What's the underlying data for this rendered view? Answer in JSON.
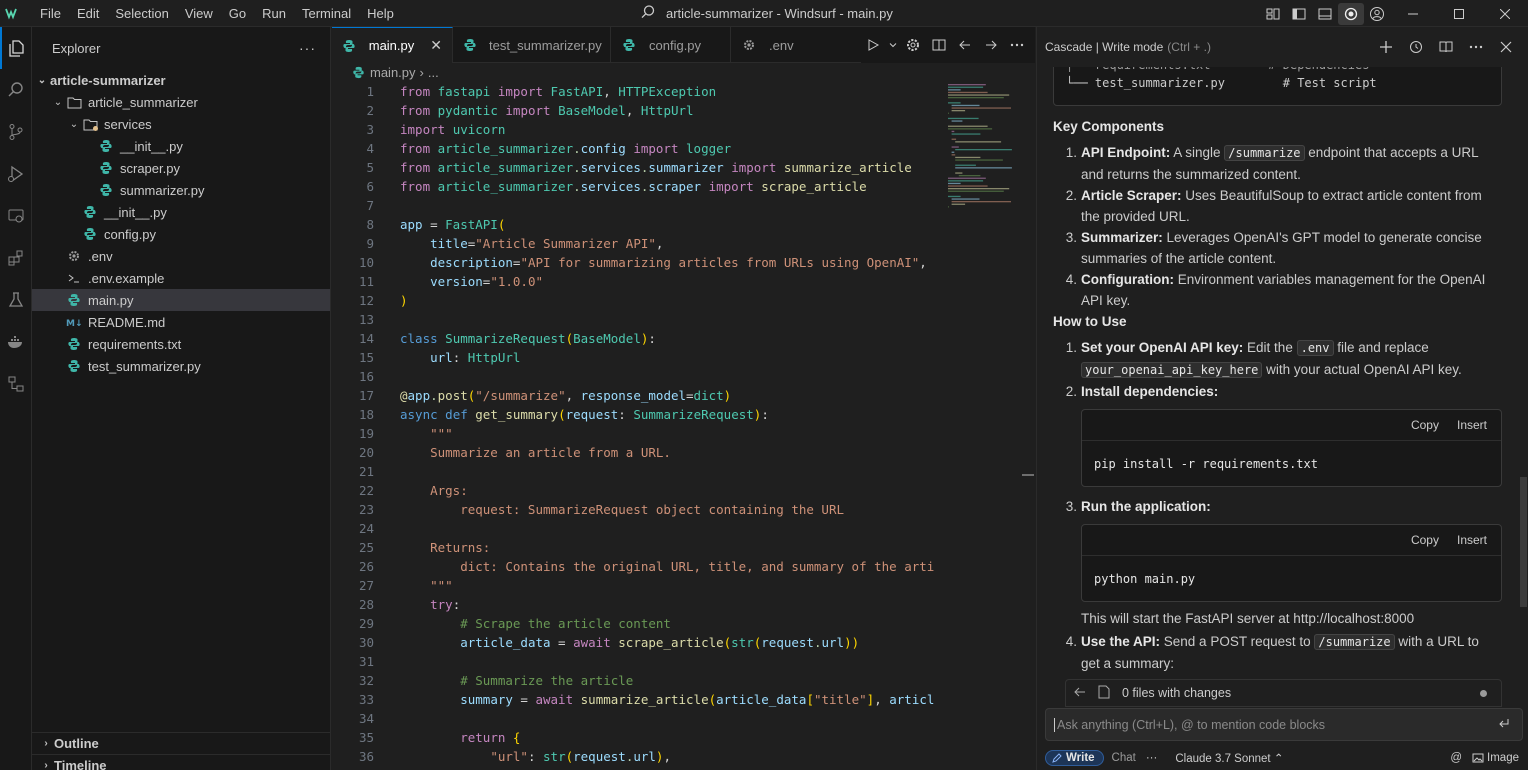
{
  "titlebar": {
    "menu": [
      "File",
      "Edit",
      "Selection",
      "View",
      "Go",
      "Run",
      "Terminal",
      "Help"
    ],
    "window_title": "article-summarizer - Windsurf - main.py",
    "window_controls": [
      "minimize",
      "maximize",
      "close"
    ]
  },
  "activity_bar": [
    "explorer-icon",
    "search-icon",
    "source-control-icon",
    "run-debug-icon",
    "remote-explorer-icon",
    "extensions-icon",
    "testing-icon",
    "docker-icon",
    "hierarchy-icon"
  ],
  "explorer": {
    "title": "Explorer",
    "more": "···",
    "root": "article-summarizer",
    "items": [
      {
        "label": "article_summarizer",
        "depth": 1,
        "type": "folder",
        "expanded": true
      },
      {
        "label": "services",
        "depth": 2,
        "type": "folder",
        "expanded": true
      },
      {
        "label": "__init__.py",
        "depth": 3,
        "type": "python"
      },
      {
        "label": "scraper.py",
        "depth": 3,
        "type": "python"
      },
      {
        "label": "summarizer.py",
        "depth": 3,
        "type": "python"
      },
      {
        "label": "__init__.py",
        "depth": 2,
        "type": "python"
      },
      {
        "label": "config.py",
        "depth": 2,
        "type": "python"
      },
      {
        "label": ".env",
        "depth": 1,
        "type": "env"
      },
      {
        "label": ".env.example",
        "depth": 1,
        "type": "shell"
      },
      {
        "label": "main.py",
        "depth": 1,
        "type": "python",
        "selected": true
      },
      {
        "label": "README.md",
        "depth": 1,
        "type": "markdown"
      },
      {
        "label": "requirements.txt",
        "depth": 1,
        "type": "python"
      },
      {
        "label": "test_summarizer.py",
        "depth": 1,
        "type": "python"
      }
    ],
    "outline_label": "Outline",
    "timeline_label": "Timeline"
  },
  "editor": {
    "tabs": [
      {
        "label": "main.py",
        "active": true,
        "closable": true
      },
      {
        "label": "test_summarizer.py",
        "active": false
      },
      {
        "label": "config.py",
        "active": false
      },
      {
        "label": ".env",
        "active": false
      }
    ],
    "breadcrumb": [
      "main.py",
      "..."
    ],
    "code_lines": [
      "from fastapi import FastAPI, HTTPException",
      "from pydantic import BaseModel, HttpUrl",
      "import uvicorn",
      "from article_summarizer.config import logger",
      "from article_summarizer.services.summarizer import summarize_article",
      "from article_summarizer.services.scraper import scrape_article",
      "",
      "app = FastAPI(",
      "    title=\"Article Summarizer API\",",
      "    description=\"API for summarizing articles from URLs using OpenAI\",",
      "    version=\"1.0.0\"",
      ")",
      "",
      "class SummarizeRequest(BaseModel):",
      "    url: HttpUrl",
      "",
      "@app.post(\"/summarize\", response_model=dict)",
      "async def get_summary(request: SummarizeRequest):",
      "    \"\"\"",
      "    Summarize an article from a URL.",
      "",
      "    Args:",
      "        request: SummarizeRequest object containing the URL",
      "",
      "    Returns:",
      "        dict: Contains the original URL, title, and summary of the arti",
      "    \"\"\"",
      "    try:",
      "        # Scrape the article content",
      "        article_data = await scrape_article(str(request.url))",
      "",
      "        # Summarize the article",
      "        summary = await summarize_article(article_data[\"title\"], articl",
      "",
      "        return {",
      "            \"url\": str(request.url),"
    ]
  },
  "cascade": {
    "title": "Cascade | Write mode",
    "shortcut": "(Ctrl + .)",
    "tree_line": "└── test_summarizer.py        # Test script",
    "key_components_heading": "Key Components",
    "key_components": [
      {
        "num": "1.",
        "title": "API Endpoint:",
        "pre": " A single ",
        "code": "/summarize",
        "post": " endpoint that accepts a URL and returns the summarized content."
      },
      {
        "num": "2.",
        "title": "Article Scraper:",
        "text": " Uses BeautifulSoup to extract article content from the provided URL."
      },
      {
        "num": "3.",
        "title": "Summarizer:",
        "text": " Leverages OpenAI's GPT model to generate concise summaries of the article content."
      },
      {
        "num": "4.",
        "title": "Configuration:",
        "text": " Environment variables management for the OpenAI API key."
      }
    ],
    "how_to_heading": "How to Use",
    "steps": {
      "s1_num": "1.",
      "s1_title": "Set your OpenAI API key:",
      "s1_pre": " Edit the ",
      "s1_code1": ".env",
      "s1_mid": " file and replace ",
      "s1_code2": "your_openai_api_key_here",
      "s1_post": " with your actual OpenAI API key.",
      "s2_num": "2.",
      "s2_title": "Install dependencies:",
      "s2_code": "pip install -r requirements.txt",
      "s3_num": "3.",
      "s3_title": "Run the application:",
      "s3_code": "python main.py",
      "s3_note": "This will start the FastAPI server at http://localhost:8000",
      "s4_num": "4.",
      "s4_title": "Use the API:",
      "s4_pre": " Send a POST request to ",
      "s4_code": "/summarize",
      "s4_post": " with a URL to get a summary:"
    },
    "copy_label": "Copy",
    "insert_label": "Insert",
    "changes_label": "0 files with changes",
    "input_placeholder": "Ask anything (Ctrl+L), @ to mention code blocks",
    "footer": {
      "write_label": "Write",
      "chat_label": "Chat",
      "more": "···",
      "model": "Claude 3.7 Sonnet",
      "image_label": "Image"
    }
  }
}
